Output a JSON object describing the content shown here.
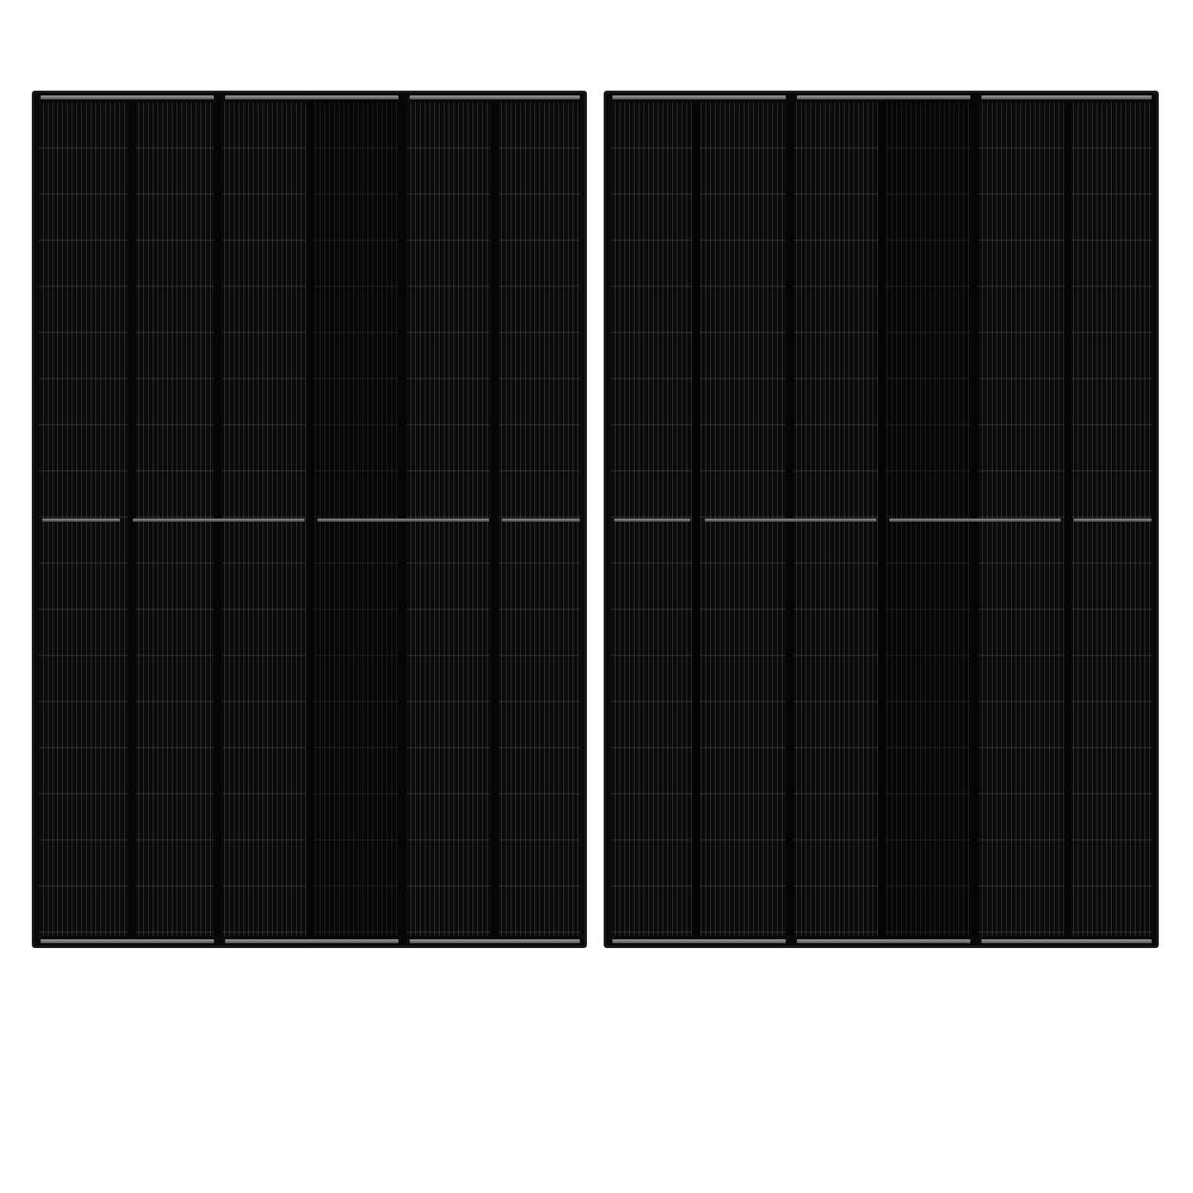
{
  "image": {
    "subject": "solar-panels",
    "panel_count": 2,
    "colors": {
      "background": "#ffffff",
      "panel": "#0a0a0a",
      "frame": "#1a1a1a",
      "busbar": "#8a8a8a"
    }
  }
}
